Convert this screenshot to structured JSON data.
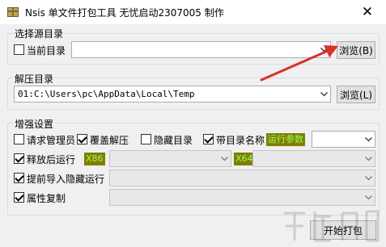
{
  "window": {
    "title": "Nsis 单文件打包工具 无忧启动2307005 制作",
    "close_glyph": "✕"
  },
  "source_group": {
    "legend": "选择源目录",
    "current_dir_label": "当前目录",
    "current_dir_checked": false,
    "path_value": "",
    "browse_label": "浏览(B)"
  },
  "extract_group": {
    "legend": "解压目录",
    "path_value": "01:C:\\Users\\pc\\AppData\\Local\\Temp",
    "browse_label": "浏览(L)"
  },
  "enhance_group": {
    "legend": "增强设置",
    "row1": [
      {
        "label": "请求管理员",
        "checked": false
      },
      {
        "label": "覆盖解压",
        "checked": true
      },
      {
        "label": "隐藏目录",
        "checked": false
      },
      {
        "label": "带目录名称",
        "checked": true
      }
    ],
    "run_params_tag": "运行参数",
    "run_params_value": "",
    "run_after": {
      "label": "释放后运行",
      "checked": true,
      "x86_tag": "X86",
      "x64_tag": "X64"
    },
    "pre_import": {
      "label": "提前导入隐藏运行",
      "checked": true
    },
    "attr_copy": {
      "label": "属性复制",
      "checked": true
    }
  },
  "footer": {
    "start_label": "开始打包"
  },
  "colors": {
    "arrow": "#d9302c",
    "tag_bg": "#7f7f00",
    "tag_fg": "#9aff5a",
    "accent": "#0078d7"
  },
  "icons": {
    "app": "archive-package-icon",
    "dropdown": "chevron-down-icon"
  }
}
